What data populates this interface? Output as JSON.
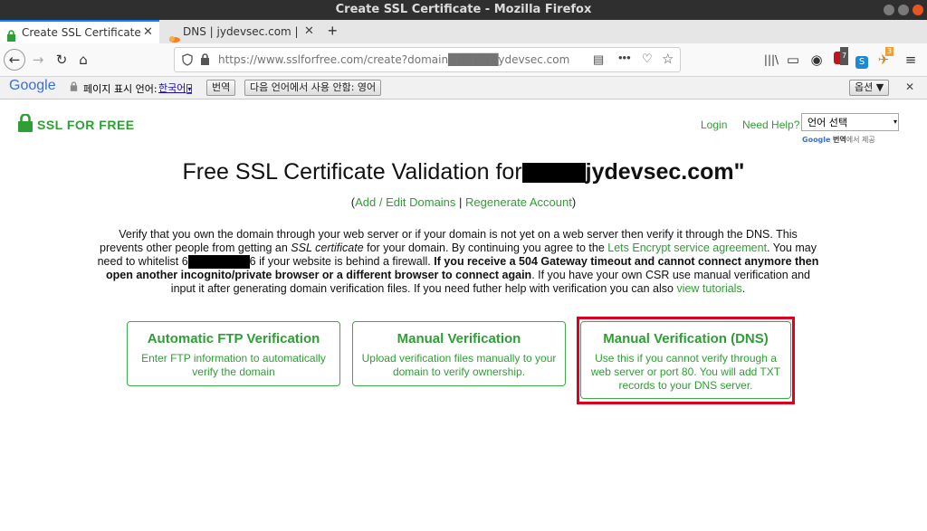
{
  "window": {
    "title": "Create SSL Certificate - Mozilla Firefox"
  },
  "tabs": [
    {
      "label": "Create SSL Certificate",
      "active": true
    },
    {
      "label": "DNS | jydevsec.com | Acc",
      "active": false
    }
  ],
  "navbar": {
    "url": "https://www.sslforfree.com/create?domain██████ydevsec.com",
    "badges": {
      "ublock": "7",
      "extension": "3"
    }
  },
  "translate_bar": {
    "google": "Google",
    "label": "페이지 표시 언어:",
    "language": "한국어",
    "translate_button": "번역",
    "never_button": "다음 언어에서 사용 안함: 영어",
    "options_button": "옵션 ▼",
    "close": "✕"
  },
  "header": {
    "logo_text": "SSL FOR FREE",
    "login": "Login",
    "help": "Need Help?",
    "language_select": "언어 선택",
    "powered_google": "Google",
    "powered_text": "번역",
    "powered_suffix": "에서 제공"
  },
  "main": {
    "title_prefix": "Free SSL Certificate Validation for",
    "title_suffix": "jydevsec.com\"",
    "open_paren": "(",
    "add_edit_domains": "Add / Edit Domains",
    "separator": " | ",
    "regenerate_account": "Regenerate Account",
    "close_paren": ")",
    "para_1": "Verify that you own the domain through your web server or if your domain is not yet on a web server then verify it through the DNS. This prevents other people from getting an ",
    "para_ssl": "SSL certificate",
    "para_2": " for your domain. By continuing you agree to the ",
    "para_lets_encrypt": "Lets Encrypt service agreement",
    "para_3": ". You may need to whitelist 6",
    "para_4": "6 if your website is behind a firewall. ",
    "para_bold": "If you receive a 504 Gateway timeout and cannot connect anymore then open another incognito/private browser or a different browser to connect again",
    "para_5": ". If you have your own CSR use manual verification and input it after generating domain verification files. If you need futher help with verification you can also ",
    "para_tutorials": "view tutorials",
    "para_6": "."
  },
  "cards": [
    {
      "title": "Automatic FTP Verification",
      "desc": "Enter FTP information to automatically verify the domain"
    },
    {
      "title": "Manual Verification",
      "desc": "Upload verification files manually to your domain to verify ownership."
    },
    {
      "title": "Manual Verification (DNS)",
      "desc": "Use this if you cannot verify through a web server or port 80. You will add TXT records to your DNS server."
    }
  ],
  "colors": {
    "brand_green": "#2f9e35",
    "highlight_red": "#e0001b",
    "titlebar": "#2f2f2f"
  }
}
